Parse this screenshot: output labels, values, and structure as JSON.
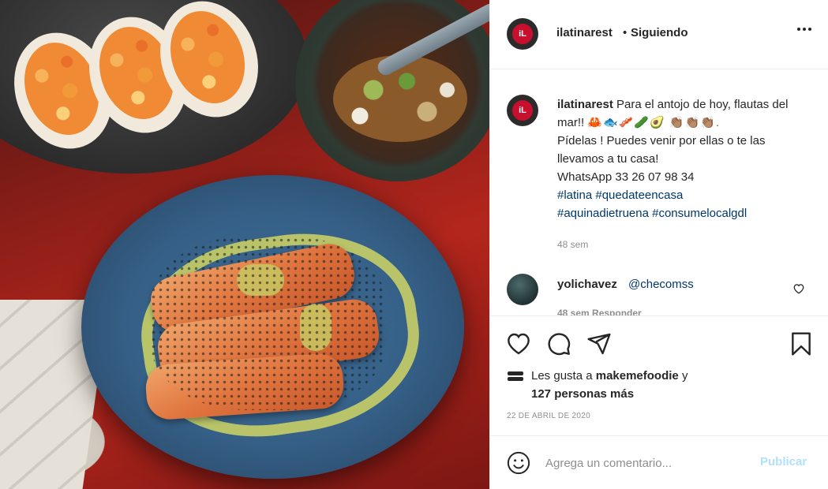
{
  "post": {
    "username": "ilatinarest",
    "separator": "•",
    "follow_status": "Siguiendo",
    "avatar_text": "iL"
  },
  "caption": {
    "username": "ilatinarest",
    "text_line1": " Para el antojo de hoy, flautas del mar!! ",
    "emojis": "🦀🐟🥓🥒🥑 👏🏽👏🏽👏🏽.",
    "text_line2": "Pídelas ! Puedes venir por ellas o te las llevamos a tu casa!",
    "whatsapp": "WhatsApp 33 26 07 98 34",
    "hashtags_line1": "#latina #quedateencasa",
    "hashtags_line2": "#aquinadietruena #consumelocalgdl",
    "time_ago": "48 sem"
  },
  "comment": {
    "username": "yolichavez",
    "mention": "@checomss",
    "meta": "48 sem   Responder"
  },
  "likes": {
    "prefix": "Les gusta a ",
    "liker": "makemefoodie",
    "suffix": " y",
    "count_text": "127 personas más"
  },
  "date": "22 DE ABRIL DE 2020",
  "composer": {
    "placeholder": "Agrega un comentario...",
    "publish_label": "Publicar"
  },
  "colors": {
    "link_blue": "#00376b",
    "publish_disabled": "#b2dffc",
    "muted_gray": "#8e8e8e"
  },
  "icons": {
    "like": "heart-icon",
    "comment": "comment-bubble-icon",
    "share": "paper-plane-icon",
    "save": "bookmark-icon",
    "options": "ellipsis-icon",
    "emoji": "smiley-icon"
  }
}
